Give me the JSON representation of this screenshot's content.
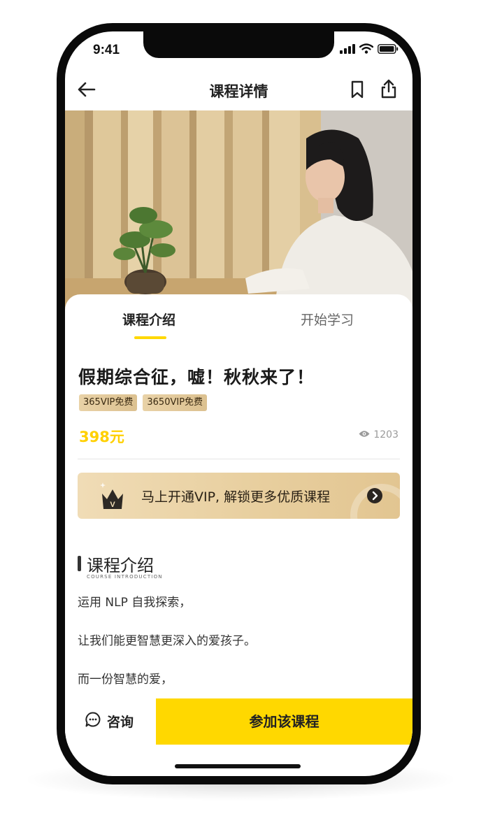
{
  "status": {
    "time": "9:41"
  },
  "nav": {
    "title": "课程详情"
  },
  "tabs": [
    {
      "label": "课程介绍",
      "active": true
    },
    {
      "label": "开始学习",
      "active": false
    }
  ],
  "course": {
    "title": "假期综合征，嘘！秋秋来了！",
    "badges": [
      "365VIP免费",
      "3650VIP免费"
    ],
    "price": "398元",
    "views": "1203"
  },
  "vip_banner": {
    "text": "马上开通VIP, 解锁更多优质课程",
    "crown_letter": "V"
  },
  "intro": {
    "title": "课程介绍",
    "subtitle": "COURSE INTRODUCTION",
    "paragraphs": [
      "运用 NLP 自我探索，",
      "让我们能更智慧更深入的爱孩子。",
      "而一份智慧的爱，"
    ]
  },
  "bottom": {
    "consult_label": "咨询",
    "join_label": "参加该课程"
  },
  "colors": {
    "accent": "#ffd800",
    "price": "#ffd000",
    "vip_gold": "#e8cf9f"
  }
}
